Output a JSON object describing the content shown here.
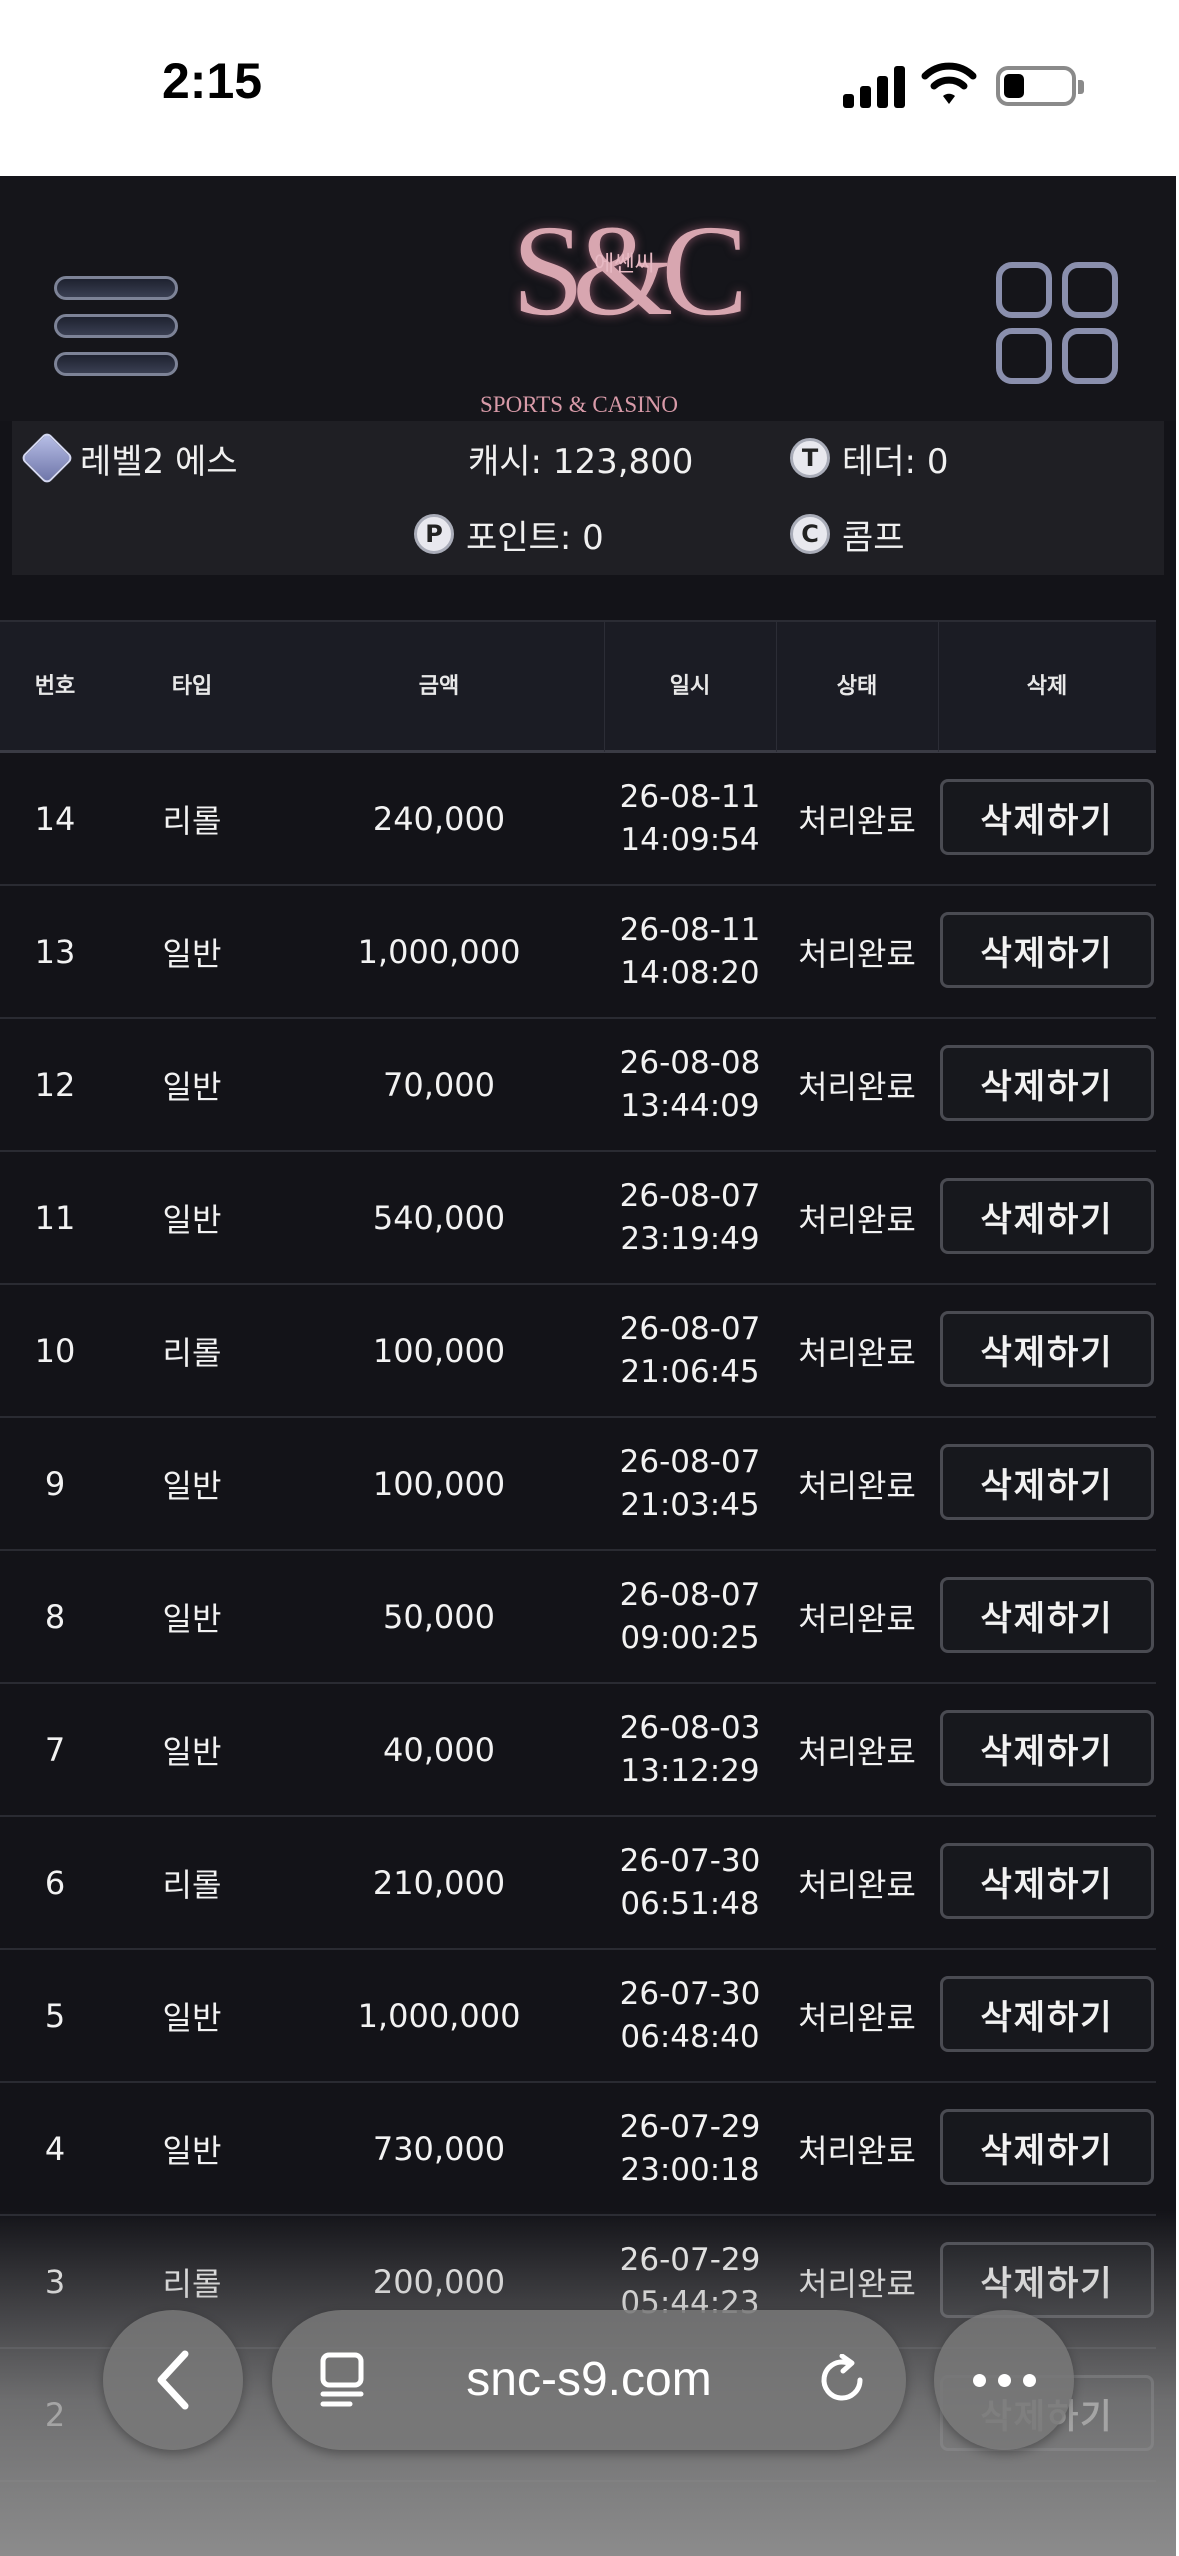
{
  "status_bar": {
    "time": "2:15"
  },
  "header": {
    "logo_monogram": "S&C",
    "logo_korean": "에쎈씨",
    "logo_subtitle": "SPORTS & CASINO"
  },
  "user": {
    "level": "레벨2 에스",
    "cash": "캐시: 123,800",
    "tether": "테더: 0",
    "points": "포인트: 0",
    "comp": "콤프",
    "tether_badge": "T",
    "points_badge": "P",
    "comp_badge": "C"
  },
  "table": {
    "headers": [
      "번호",
      "타입",
      "금액",
      "일시",
      "상태",
      "삭제"
    ],
    "rows": [
      {
        "no": "14",
        "type": "리롤",
        "amount": "240,000",
        "date": "26-08-11",
        "time": "14:09:54",
        "status": "처리완료",
        "action": "삭제하기"
      },
      {
        "no": "13",
        "type": "일반",
        "amount": "1,000,000",
        "date": "26-08-11",
        "time": "14:08:20",
        "status": "처리완료",
        "action": "삭제하기"
      },
      {
        "no": "12",
        "type": "일반",
        "amount": "70,000",
        "date": "26-08-08",
        "time": "13:44:09",
        "status": "처리완료",
        "action": "삭제하기"
      },
      {
        "no": "11",
        "type": "일반",
        "amount": "540,000",
        "date": "26-08-07",
        "time": "23:19:49",
        "status": "처리완료",
        "action": "삭제하기"
      },
      {
        "no": "10",
        "type": "리롤",
        "amount": "100,000",
        "date": "26-08-07",
        "time": "21:06:45",
        "status": "처리완료",
        "action": "삭제하기"
      },
      {
        "no": "9",
        "type": "일반",
        "amount": "100,000",
        "date": "26-08-07",
        "time": "21:03:45",
        "status": "처리완료",
        "action": "삭제하기"
      },
      {
        "no": "8",
        "type": "일반",
        "amount": "50,000",
        "date": "26-08-07",
        "time": "09:00:25",
        "status": "처리완료",
        "action": "삭제하기"
      },
      {
        "no": "7",
        "type": "일반",
        "amount": "40,000",
        "date": "26-08-03",
        "time": "13:12:29",
        "status": "처리완료",
        "action": "삭제하기"
      },
      {
        "no": "6",
        "type": "리롤",
        "amount": "210,000",
        "date": "26-07-30",
        "time": "06:51:48",
        "status": "처리완료",
        "action": "삭제하기"
      },
      {
        "no": "5",
        "type": "일반",
        "amount": "1,000,000",
        "date": "26-07-30",
        "time": "06:48:40",
        "status": "처리완료",
        "action": "삭제하기"
      },
      {
        "no": "4",
        "type": "일반",
        "amount": "730,000",
        "date": "26-07-29",
        "time": "23:00:18",
        "status": "처리완료",
        "action": "삭제하기"
      },
      {
        "no": "3",
        "type": "리롤",
        "amount": "200,000",
        "date": "26-07-29",
        "time": "05:44:23",
        "status": "처리완료",
        "action": "삭제하기"
      },
      {
        "no": "2",
        "type": "",
        "amount": "",
        "date": "",
        "time": "",
        "status": "",
        "action": "삭제하기"
      }
    ]
  },
  "browser": {
    "url": "snc-s9.com"
  }
}
